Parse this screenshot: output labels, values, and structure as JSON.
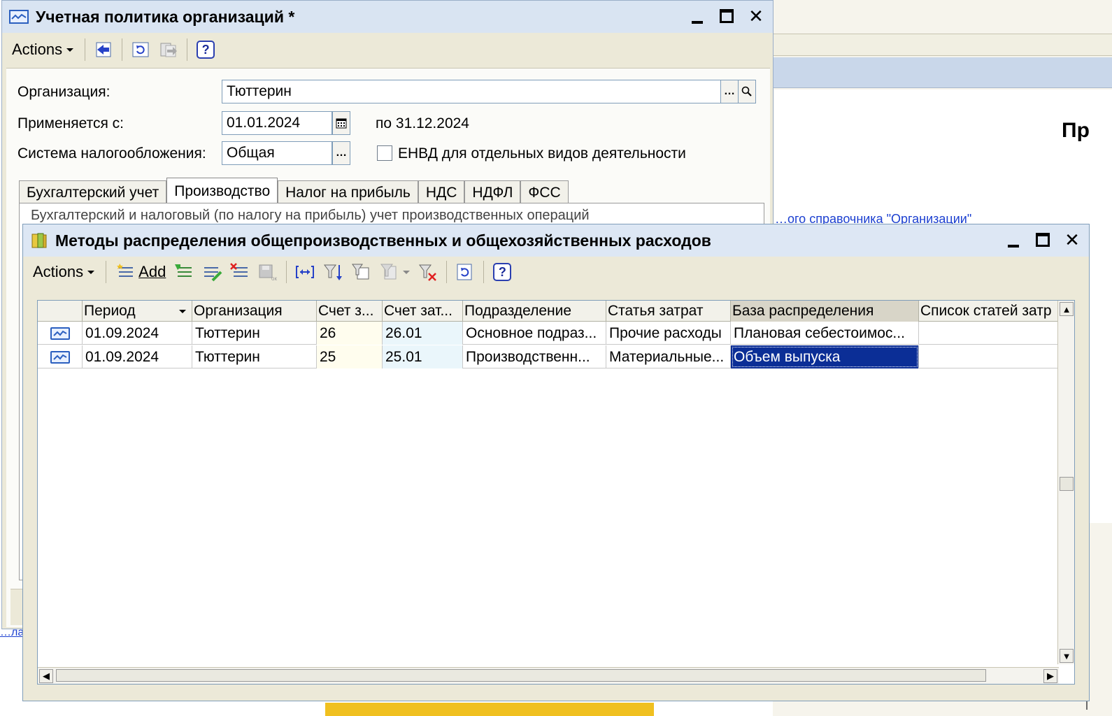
{
  "background": {
    "heading_fragment": "Пр",
    "link_fragment": "…ого справочника \"Организации\"",
    "bottom_link_fragment": "…лао"
  },
  "policy_window": {
    "title": "Учетная политика организаций *",
    "toolbar": {
      "actions_label": "Actions"
    },
    "form": {
      "organization_label": "Организация:",
      "organization_value": "Тюттерин",
      "applies_from_label": "Применяется с:",
      "applies_from_value": "01.01.2024",
      "period_to_text": "по 31.12.2024",
      "tax_system_label": "Система налогообложения:",
      "tax_system_value": "Общая",
      "envd_label": "ЕНВД для отдельных видов деятельности"
    },
    "tabs": [
      {
        "label": "Бухгалтерский учет"
      },
      {
        "label": "Производство"
      },
      {
        "label": "Налог на прибыль"
      },
      {
        "label": "НДС"
      },
      {
        "label": "НДФЛ"
      },
      {
        "label": "ФСС"
      }
    ],
    "active_tab_index": 1,
    "tab_content_text": "Бухгалтерский и налоговый (по налогу на прибыль) учет производственных операций"
  },
  "methods_window": {
    "title": "Методы распределения общепроизводственных и общехозяйственных расходов",
    "toolbar": {
      "actions_label": "Actions",
      "add_label": "Add"
    },
    "columns": [
      "Период",
      "Организация",
      "Счет з...",
      "Счет зат...",
      "Подразделение",
      "Статья затрат",
      "База распределения",
      "Список статей затр"
    ],
    "rows": [
      {
        "period": "01.09.2024",
        "org": "Тюттерин",
        "acc1": "26",
        "acc2": "26.01",
        "dept": "Основное подраз...",
        "cost_item": "Прочие расходы",
        "base": "Плановая себестоимос...",
        "list": ""
      },
      {
        "period": "01.09.2024",
        "org": "Тюттерин",
        "acc1": "25",
        "acc2": "25.01",
        "dept": "Производственн...",
        "cost_item": "Материальные...",
        "base": "Объем выпуска",
        "list": ""
      }
    ],
    "selected_row_index": 1,
    "selected_column": "base"
  },
  "colors": {
    "selection": "#0b2e96",
    "titlebar": "#dde7f4",
    "window_bg": "#ece9d8",
    "link": "#1b3fd0"
  }
}
